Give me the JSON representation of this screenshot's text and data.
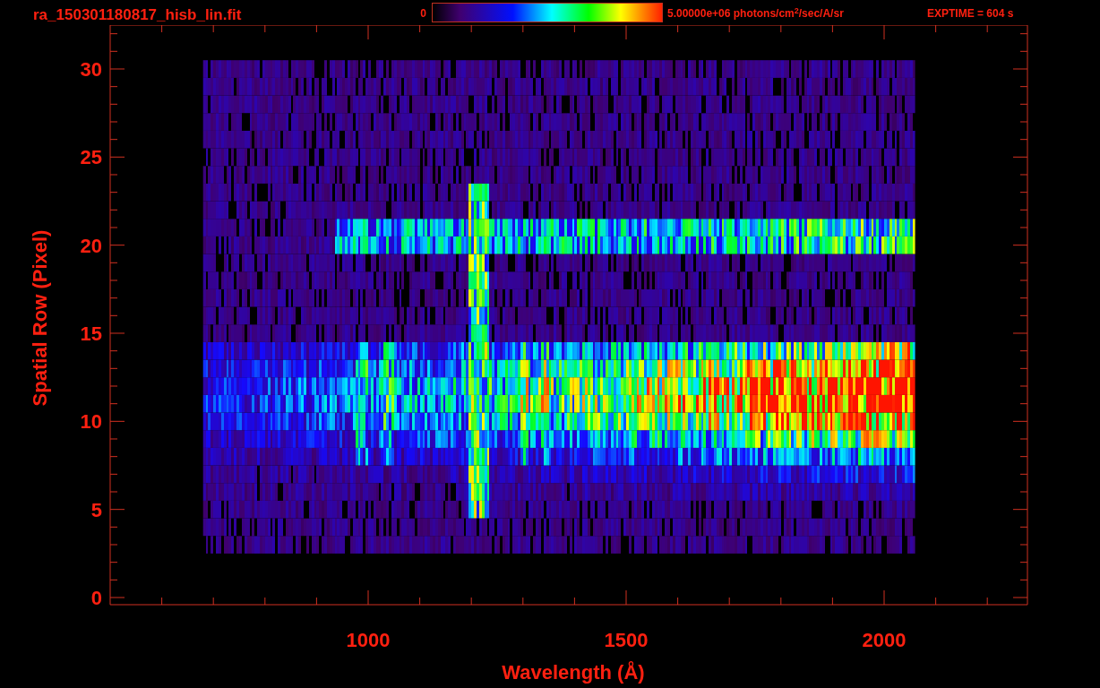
{
  "title": "ra_150301180817_hisb_lin.fit",
  "colorbar": {
    "min_label": "0",
    "max_label": "5.00000e+06 photons/cm$^{2}$/sec/A/sr"
  },
  "exptime": "EXPTIME = 604 s",
  "plot": {
    "xlabel": "Wavelength (Å)",
    "ylabel": "Spatial Row (Pixel)",
    "x_tick_labels": [
      "1000",
      "1500",
      "2000"
    ],
    "y_tick_labels": [
      "30",
      "25",
      "20",
      "15",
      "10",
      "5",
      "0"
    ]
  }
}
